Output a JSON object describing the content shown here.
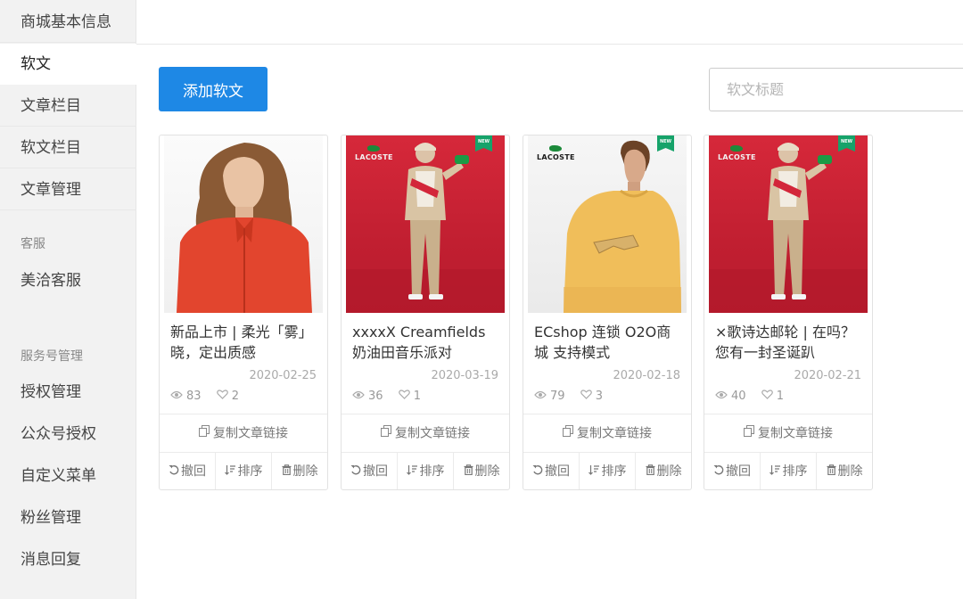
{
  "sidebar": {
    "items_top": [
      {
        "label": "商城基本信息",
        "active": false
      },
      {
        "label": "软文",
        "active": true
      },
      {
        "label": "文章栏目",
        "active": false
      },
      {
        "label": "软文栏目",
        "active": false
      },
      {
        "label": "文章管理",
        "active": false
      }
    ],
    "group_service": "客服",
    "service_items": [
      {
        "label": "美洽客服"
      }
    ],
    "group_fuwuhao": "服务号管理",
    "fuwuhao_items": [
      {
        "label": "授权管理"
      },
      {
        "label": "公众号授权"
      },
      {
        "label": "自定义菜单"
      },
      {
        "label": "粉丝管理"
      },
      {
        "label": "消息回复"
      }
    ]
  },
  "toolbar": {
    "add_label": "添加软文",
    "search_placeholder": "软文标题"
  },
  "cards": [
    {
      "title": "新品上市 | 柔光「雾」晓，定出质感",
      "date": "2020-02-25",
      "views": "83",
      "likes": "2",
      "copy_label": "复制文章链接",
      "revoke_label": "撤回",
      "sort_label": "排序",
      "delete_label": "删除",
      "brand": "",
      "new_tag": ""
    },
    {
      "title": "xxxxX Creamfields 奶油田音乐派对",
      "date": "2020-03-19",
      "views": "36",
      "likes": "1",
      "copy_label": "复制文章链接",
      "revoke_label": "撤回",
      "sort_label": "排序",
      "delete_label": "删除",
      "brand": "LACOSTE",
      "new_tag": "NEW"
    },
    {
      "title": "ECshop 连锁 O2O商城 支持模式",
      "date": "2020-02-18",
      "views": "79",
      "likes": "3",
      "copy_label": "复制文章链接",
      "revoke_label": "撤回",
      "sort_label": "排序",
      "delete_label": "删除",
      "brand": "LACOSTE",
      "new_tag": "NEW"
    },
    {
      "title": "×歌诗达邮轮 | 在吗？您有一封圣诞趴",
      "date": "2020-02-21",
      "views": "40",
      "likes": "1",
      "copy_label": "复制文章链接",
      "revoke_label": "撤回",
      "sort_label": "排序",
      "delete_label": "删除",
      "brand": "LACOSTE",
      "new_tag": "NEW"
    }
  ],
  "colors": {
    "primary": "#1e88e5",
    "sidebar_bg": "#f2f2f2",
    "thumb_red": "#c81f33",
    "sweater_yellow": "#f0be5a",
    "jacket_red": "#e2452e",
    "tag_green": "#16a36a"
  }
}
